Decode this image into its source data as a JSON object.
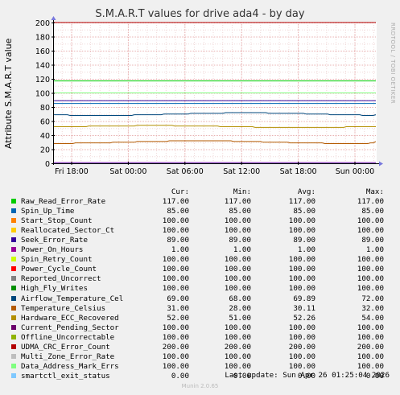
{
  "chart_data": {
    "type": "line",
    "title": "S.M.A.R.T values for drive ada4 - by day",
    "ylabel": "Attribute S.M.A.R.T value",
    "side_label": "RRDTOOL / TOBI OETIKER",
    "ylim": [
      0,
      200
    ],
    "yticks": [
      "0",
      "20",
      "40",
      "60",
      "80",
      "100",
      "120",
      "140",
      "160",
      "180",
      "200"
    ],
    "xticks": [
      "Fri 18:00",
      "Sat 00:00",
      "Sat 06:00",
      "Sat 12:00",
      "Sat 18:00",
      "Sun 00:00"
    ],
    "grid": true,
    "header": {
      "cur": "Cur:",
      "min": "Min:",
      "avg": "Avg:",
      "max": "Max:"
    },
    "series": [
      {
        "name": "Raw_Read_Error_Rate",
        "color": "#00cc00",
        "cur": "117.00",
        "min": "117.00",
        "avg": "117.00",
        "max": "117.00"
      },
      {
        "name": "Spin_Up_Time",
        "color": "#0066b3",
        "cur": "85.00",
        "min": "85.00",
        "avg": "85.00",
        "max": "85.00"
      },
      {
        "name": "Start_Stop_Count",
        "color": "#ff8000",
        "cur": "100.00",
        "min": "100.00",
        "avg": "100.00",
        "max": "100.00"
      },
      {
        "name": "Reallocated_Sector_Ct",
        "color": "#ffcc00",
        "cur": "100.00",
        "min": "100.00",
        "avg": "100.00",
        "max": "100.00"
      },
      {
        "name": "Seek_Error_Rate",
        "color": "#330099",
        "cur": "89.00",
        "min": "89.00",
        "avg": "89.00",
        "max": "89.00"
      },
      {
        "name": "Power_On_Hours",
        "color": "#990099",
        "cur": "1.00",
        "min": "1.00",
        "avg": "1.00",
        "max": "1.00"
      },
      {
        "name": "Spin_Retry_Count",
        "color": "#ccff00",
        "cur": "100.00",
        "min": "100.00",
        "avg": "100.00",
        "max": "100.00"
      },
      {
        "name": "Power_Cycle_Count",
        "color": "#ff0000",
        "cur": "100.00",
        "min": "100.00",
        "avg": "100.00",
        "max": "100.00"
      },
      {
        "name": "Reported_Uncorrect",
        "color": "#808080",
        "cur": "100.00",
        "min": "100.00",
        "avg": "100.00",
        "max": "100.00"
      },
      {
        "name": "High_Fly_Writes",
        "color": "#008f00",
        "cur": "100.00",
        "min": "100.00",
        "avg": "100.00",
        "max": "100.00"
      },
      {
        "name": "Airflow_Temperature_Cel",
        "color": "#00487d",
        "cur": "69.00",
        "min": "68.00",
        "avg": "69.89",
        "max": "72.00"
      },
      {
        "name": "Temperature_Celsius",
        "color": "#b35a00",
        "cur": "31.00",
        "min": "28.00",
        "avg": "30.11",
        "max": "32.00"
      },
      {
        "name": "Hardware_ECC_Recovered",
        "color": "#b38f00",
        "cur": "52.00",
        "min": "51.00",
        "avg": "52.26",
        "max": "54.00"
      },
      {
        "name": "Current_Pending_Sector",
        "color": "#6b006b",
        "cur": "100.00",
        "min": "100.00",
        "avg": "100.00",
        "max": "100.00"
      },
      {
        "name": "Offline_Uncorrectable",
        "color": "#8fb300",
        "cur": "100.00",
        "min": "100.00",
        "avg": "100.00",
        "max": "100.00"
      },
      {
        "name": "UDMA_CRC_Error_Count",
        "color": "#b30000",
        "cur": "200.00",
        "min": "200.00",
        "avg": "200.00",
        "max": "200.00"
      },
      {
        "name": "Multi_Zone_Error_Rate",
        "color": "#bebebe",
        "cur": "100.00",
        "min": "100.00",
        "avg": "100.00",
        "max": "100.00"
      },
      {
        "name": "Data_Address_Mark_Errs",
        "color": "#80ff80",
        "cur": "100.00",
        "min": "100.00",
        "avg": "100.00",
        "max": "100.00"
      },
      {
        "name": "smartctl_exit_status",
        "color": "#80c9ff",
        "cur": "0.00",
        "min": "0.00",
        "avg": "0.00",
        "max": "0.00"
      }
    ]
  },
  "footer": {
    "last_update": "Last update: Sun Apr 26 01:25:04 2026",
    "version": "Munin 2.0.65"
  }
}
